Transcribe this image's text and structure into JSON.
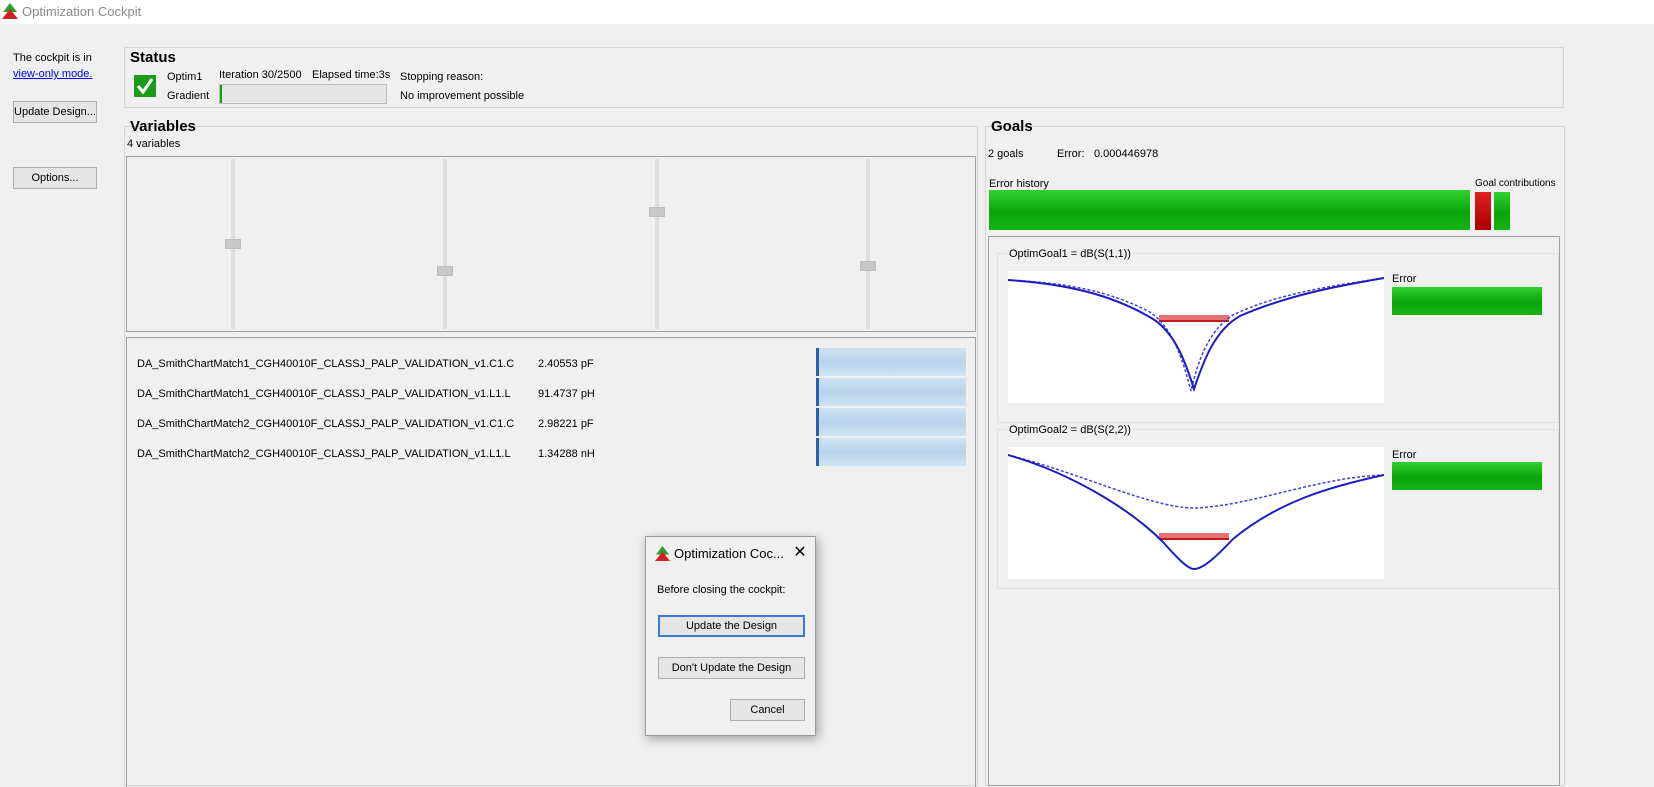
{
  "window": {
    "title": "Optimization Cockpit",
    "icon": "optimization-tree-icon"
  },
  "left": {
    "view_note": "The cockpit is in",
    "view_link": "view-only mode.",
    "update_button": "Update Design...",
    "options_button": "Options..."
  },
  "status": {
    "heading": "Status",
    "check_icon": "check-icon",
    "optim_name": "Optim1",
    "method": "Gradient",
    "iteration": "Iteration 30/2500",
    "elapsed": "Elapsed time:3s",
    "stopping_label": "Stopping reason:",
    "stopping_value": "No improvement possible"
  },
  "variables": {
    "heading": "Variables",
    "count": "4 variables",
    "slider_levels": [
      0.5,
      0.66,
      0.31,
      0.63
    ],
    "items": [
      {
        "name": "DA_SmithChartMatch1_CGH40010F_CLASSJ_PALP_VALIDATION_v1.C1.C",
        "value": "2.40553 pF"
      },
      {
        "name": "DA_SmithChartMatch1_CGH40010F_CLASSJ_PALP_VALIDATION_v1.L1.L",
        "value": "91.4737 pH"
      },
      {
        "name": "DA_SmithChartMatch2_CGH40010F_CLASSJ_PALP_VALIDATION_v1.C1.C",
        "value": "2.98221 pF"
      },
      {
        "name": "DA_SmithChartMatch2_CGH40010F_CLASSJ_PALP_VALIDATION_v1.L1.L",
        "value": "1.34288 nH"
      }
    ]
  },
  "goals": {
    "heading": "Goals",
    "count": "2 goals",
    "error_label": "Error:",
    "error_value": "0.000446978",
    "error_history_label": "Error history",
    "contributions_label": "Goal contributions",
    "goal1": {
      "title": "OptimGoal1 = dB(S(1,1))",
      "error_label": "Error"
    },
    "goal2": {
      "title": "OptimGoal2 = dB(S(2,2))",
      "error_label": "Error"
    }
  },
  "dialog": {
    "title": "Optimization Coc...",
    "icon": "optimization-tree-icon",
    "close_icon": "close-icon",
    "message": "Before closing the cockpit:",
    "update": "Update the Design",
    "dont_update": "Don't Update the Design",
    "cancel": "Cancel"
  },
  "colors": {
    "accent_blue": "#1c1cbf",
    "goal_red": "#d42020",
    "progress_green": "#0aa40a",
    "link": "#0000ee"
  }
}
